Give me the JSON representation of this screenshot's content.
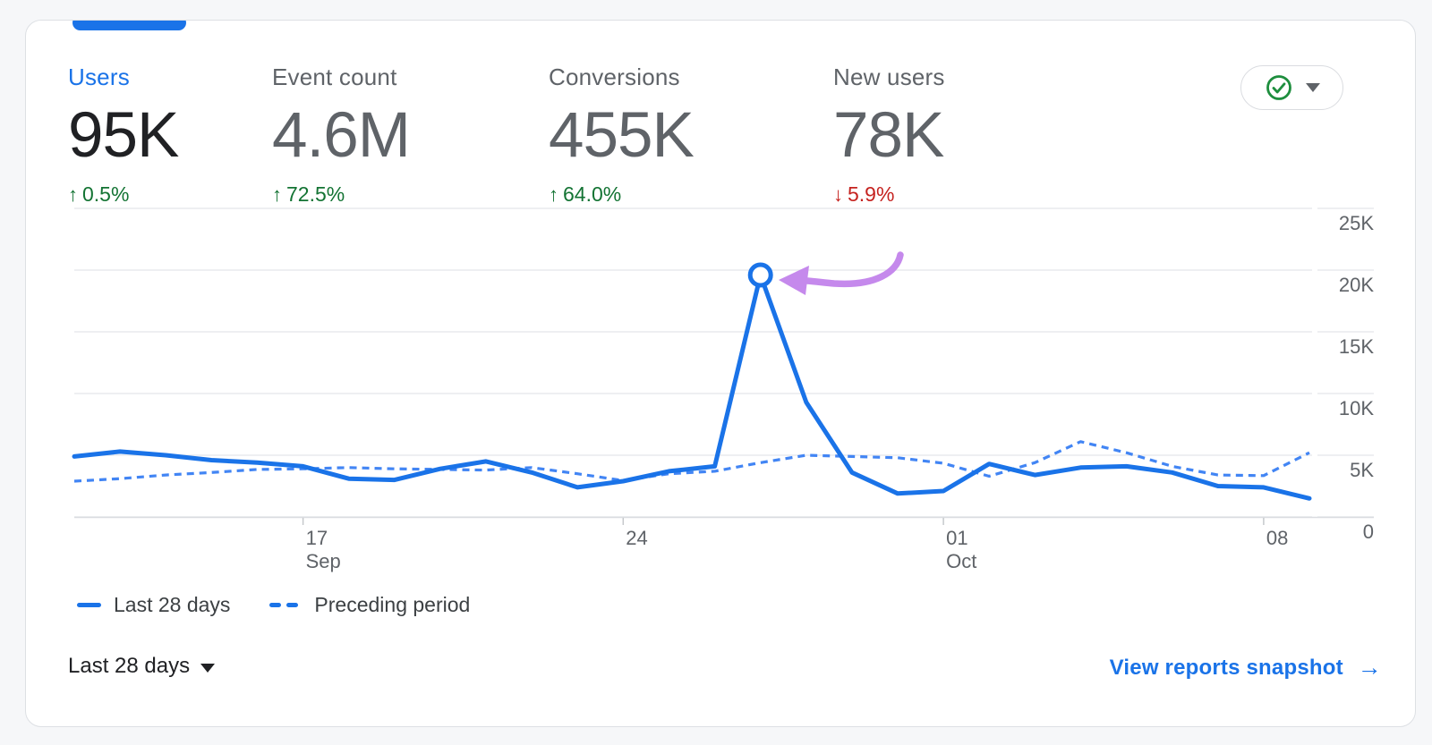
{
  "metrics": [
    {
      "label": "Users",
      "value": "95K",
      "delta": "0.5%",
      "direction": "up",
      "selected": true
    },
    {
      "label": "Event count",
      "value": "4.6M",
      "delta": "72.5%",
      "direction": "up",
      "selected": false
    },
    {
      "label": "Conversions",
      "value": "455K",
      "delta": "64.0%",
      "direction": "up",
      "selected": false
    },
    {
      "label": "New users",
      "value": "78K",
      "delta": "5.9%",
      "direction": "down",
      "selected": false
    }
  ],
  "selector": {
    "status_icon": "check-circle",
    "status": "ok"
  },
  "chart_data": {
    "type": "line",
    "x_range_days": 28,
    "grid": "horizontal",
    "legend_position": "bottom-left",
    "ylim": [
      0,
      25000
    ],
    "y_ticks": [
      {
        "value": 25000,
        "label": "25K"
      },
      {
        "value": 20000,
        "label": "20K"
      },
      {
        "value": 15000,
        "label": "15K"
      },
      {
        "value": 10000,
        "label": "10K"
      },
      {
        "value": 5000,
        "label": "5K"
      },
      {
        "value": 0,
        "label": "0"
      }
    ],
    "x_ticks": [
      {
        "day": 5,
        "label": "17",
        "sublabel": "Sep"
      },
      {
        "day": 12,
        "label": "24",
        "sublabel": ""
      },
      {
        "day": 19,
        "label": "01",
        "sublabel": "Oct"
      },
      {
        "day": 26,
        "label": "08",
        "sublabel": ""
      }
    ],
    "series": [
      {
        "name": "Last 28 days",
        "style": "solid",
        "values": [
          4900,
          5300,
          5000,
          4600,
          4400,
          4100,
          3100,
          3000,
          3900,
          4500,
          3600,
          2400,
          2900,
          3700,
          4100,
          19600,
          9300,
          3600,
          1900,
          2100,
          4300,
          3400,
          4000,
          4100,
          3600,
          2500,
          2400,
          1500
        ]
      },
      {
        "name": "Preceding period",
        "style": "dashed",
        "values": [
          2900,
          3100,
          3400,
          3600,
          3850,
          3900,
          4000,
          3900,
          3850,
          3800,
          4000,
          3500,
          2950,
          3500,
          3700,
          4400,
          5000,
          4900,
          4800,
          4350,
          3300,
          4400,
          6100,
          5200,
          4100,
          3400,
          3350,
          5200
        ]
      }
    ],
    "annotation": {
      "type": "arrow-to-peak",
      "marker_day": 15,
      "marker_value": 19600
    }
  },
  "footer": {
    "range_label": "Last 28 days",
    "link_label": "View reports snapshot"
  },
  "icons": {
    "delta_up": "↑",
    "delta_down": "↓",
    "link_arrow": "→"
  },
  "colors": {
    "accent": "#1a73e8",
    "positive": "#137333",
    "negative": "#c5221f",
    "annotation_arrow": "#c589ec",
    "check_icon": "#1e8e3e",
    "muted_text": "#5f6368",
    "value_text": "#202124",
    "gridline": "#e8eaed"
  }
}
